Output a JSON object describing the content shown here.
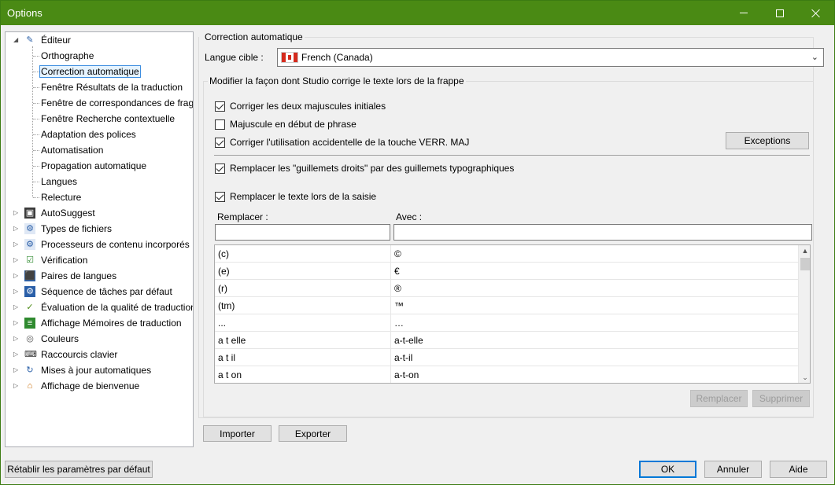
{
  "window": {
    "title": "Options"
  },
  "tree": {
    "items": [
      {
        "label": "Éditeur",
        "level": 0,
        "expander": "open",
        "icon": "pencil-icon"
      },
      {
        "label": "Orthographe",
        "level": 1
      },
      {
        "label": "Correction automatique",
        "level": 1,
        "selected": true
      },
      {
        "label": "Fenêtre Résultats de la traduction",
        "level": 1
      },
      {
        "label": "Fenêtre de correspondances de fragm",
        "level": 1
      },
      {
        "label": "Fenêtre Recherche contextuelle",
        "level": 1
      },
      {
        "label": "Adaptation des polices",
        "level": 1
      },
      {
        "label": "Automatisation",
        "level": 1
      },
      {
        "label": "Propagation automatique",
        "level": 1
      },
      {
        "label": "Langues",
        "level": 1
      },
      {
        "label": "Relecture",
        "level": 1
      },
      {
        "label": "AutoSuggest",
        "level": 0,
        "expander": "closed",
        "icon": "autosuggest-icon"
      },
      {
        "label": "Types de fichiers",
        "level": 0,
        "expander": "closed",
        "icon": "filetypes-icon"
      },
      {
        "label": "Processeurs de contenu incorporés",
        "level": 0,
        "expander": "closed",
        "icon": "processor-icon"
      },
      {
        "label": "Vérification",
        "level": 0,
        "expander": "closed",
        "icon": "verification-icon"
      },
      {
        "label": "Paires de langues",
        "level": 0,
        "expander": "closed",
        "icon": "language-pairs-icon"
      },
      {
        "label": "Séquence de tâches par défaut",
        "level": 0,
        "expander": "closed",
        "icon": "task-sequence-icon"
      },
      {
        "label": "Évaluation de la qualité de traduction",
        "level": 0,
        "expander": "closed",
        "icon": "quality-icon"
      },
      {
        "label": "Affichage Mémoires de traduction",
        "level": 0,
        "expander": "closed",
        "icon": "memory-icon"
      },
      {
        "label": "Couleurs",
        "level": 0,
        "expander": "closed",
        "icon": "palette-icon"
      },
      {
        "label": "Raccourcis clavier",
        "level": 0,
        "expander": "closed",
        "icon": "keyboard-icon"
      },
      {
        "label": "Mises à jour automatiques",
        "level": 0,
        "expander": "closed",
        "icon": "update-icon"
      },
      {
        "label": "Affichage de bienvenue",
        "level": 0,
        "expander": "closed",
        "icon": "home-icon"
      }
    ]
  },
  "panel": {
    "title": "Correction automatique",
    "lang_label": "Langue cible :",
    "lang_value": "French (Canada)",
    "group_title": "Modifier la façon dont Studio corrige le texte lors de la frappe",
    "options": [
      {
        "label": "Corriger les deux majuscules initiales",
        "checked": true
      },
      {
        "label": "Majuscule en début de phrase",
        "checked": false
      },
      {
        "label": "Corriger l'utilisation accidentelle de la touche VERR. MAJ",
        "checked": true
      },
      {
        "label": "Remplacer les \"guillemets droits\" par des guillemets typographiques",
        "checked": true
      },
      {
        "label": "Remplacer le texte lors de la saisie",
        "checked": true
      }
    ],
    "exceptions_label": "Exceptions",
    "replace_col_label": "Remplacer :",
    "with_col_label": "Avec :",
    "replace_input": "",
    "with_input": "",
    "rows": [
      {
        "from": "(c)",
        "to": "©"
      },
      {
        "from": "(e)",
        "to": "€"
      },
      {
        "from": "(r)",
        "to": "®"
      },
      {
        "from": "(tm)",
        "to": "™"
      },
      {
        "from": "...",
        "to": "…"
      },
      {
        "from": "a t elle",
        "to": "a-t-elle"
      },
      {
        "from": "a t il",
        "to": "a-t-il"
      },
      {
        "from": "a t on",
        "to": "a-t-on"
      }
    ],
    "replace_button": "Remplacer",
    "delete_button": "Supprimer",
    "import_button": "Importer",
    "export_button": "Exporter"
  },
  "footer": {
    "reset_button": "Rétablir les paramètres par défaut",
    "ok_button": "OK",
    "cancel_button": "Annuler",
    "help_button": "Aide"
  },
  "colors": {
    "titlebar": "#4a8a14",
    "accent": "#0078d7",
    "selection": "#e5f3ff"
  }
}
